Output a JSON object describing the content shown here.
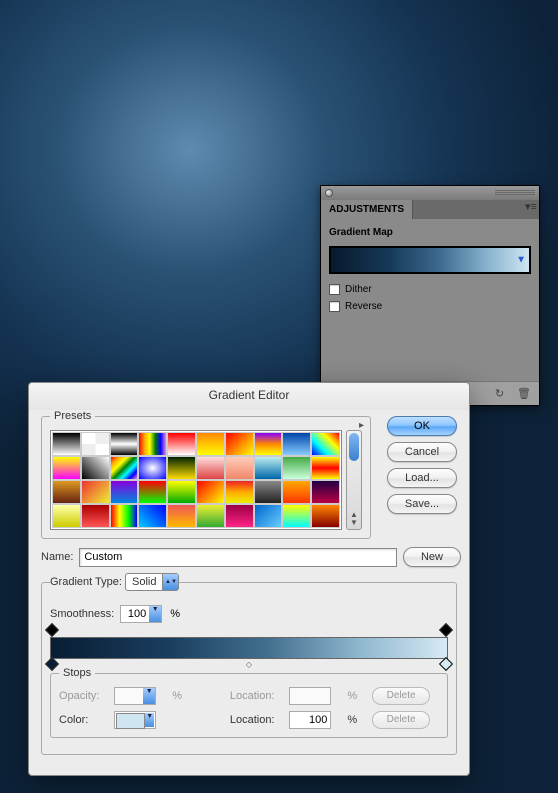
{
  "adjustments": {
    "tab": "ADJUSTMENTS",
    "title": "Gradient Map",
    "dither": "Dither",
    "reverse": "Reverse"
  },
  "dialog": {
    "title": "Gradient Editor",
    "presets_legend": "Presets",
    "name_label": "Name:",
    "name_value": "Custom",
    "btn_ok": "OK",
    "btn_cancel": "Cancel",
    "btn_load": "Load...",
    "btn_save": "Save...",
    "btn_new": "New",
    "gtype_label": "Gradient Type:",
    "gtype_value": "Solid",
    "smooth_label": "Smoothness:",
    "smooth_value": "100",
    "stops_legend": "Stops",
    "opacity_label": "Opacity:",
    "location_label": "Location:",
    "location_value": "100",
    "color_label": "Color:",
    "delete": "Delete",
    "pct": "%"
  },
  "preset_styles": [
    "linear-gradient(#000,#fff)",
    "repeating-conic-gradient(#eee 0 25%,#fff 0 50%)",
    "linear-gradient(#000,#fff,#000)",
    "linear-gradient(90deg,red,orange,yellow,green,blue,violet)",
    "linear-gradient(#f00,transparent)",
    "linear-gradient(#f80,#ff0)",
    "linear-gradient(135deg,#f00,#ff0)",
    "linear-gradient(#80f,#f80,#ff0)",
    "linear-gradient(#04a,#8cf)",
    "linear-gradient(45deg,blue,cyan,yellow,red)",
    "linear-gradient(#ff0,#f0f)",
    "linear-gradient(45deg,#000,#fff)",
    "linear-gradient(135deg,red,orange,yellow,green,cyan,blue,violet)",
    "radial-gradient(#fff,#00f)",
    "linear-gradient(#020,#fd0)",
    "linear-gradient(#fdd,#d44)",
    "linear-gradient(#fcb,#e86)",
    "linear-gradient(#bee,#06a)",
    "linear-gradient(#4a4,#cfd)",
    "linear-gradient(#ff0,#f00,#ff0)",
    "linear-gradient(#d92,#621)",
    "linear-gradient(135deg,#e33,#ee3)",
    "linear-gradient(#80d,#08d)",
    "linear-gradient(#f00,#0f0)",
    "linear-gradient(#ff0,#0a0)",
    "linear-gradient(135deg,#f00,#ff0)",
    "linear-gradient(#e22,#fa0,#ee0)",
    "linear-gradient(#888,#222)",
    "linear-gradient(#fa0,#f30)",
    "linear-gradient(#204,#b04)",
    "linear-gradient(#ffa,#cc0)",
    "linear-gradient(#a00,#f55)",
    "linear-gradient(90deg,#f00,#ff0,#0f0,#00f)",
    "linear-gradient(45deg,#0cf,#00f)",
    "linear-gradient(#e55,#fb0)",
    "linear-gradient(#ee3,#3a3)",
    "linear-gradient(#904,#f28)",
    "linear-gradient(135deg,#06c,#6cf)",
    "linear-gradient(#ff0,#0ff)",
    "linear-gradient(#f80,#800)"
  ]
}
